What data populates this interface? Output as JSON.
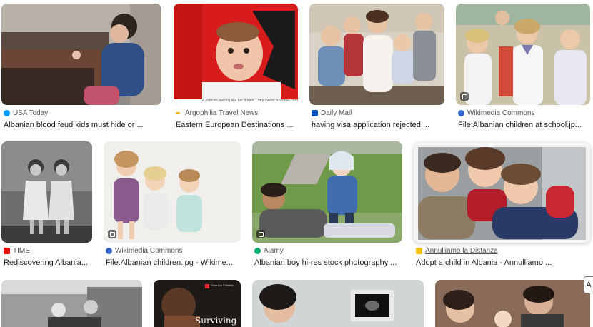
{
  "results": [
    {
      "source": "USA Today",
      "title": "Albanian blood feud kids must hide or ...",
      "favicon_color": "#009bff"
    },
    {
      "source": "Argophilia Travel News",
      "title": "Eastern European Destinations ...",
      "favicon_color": "#f4b400"
    },
    {
      "source": "Daily Mail",
      "title": "having visa application rejected ...",
      "favicon_color": "#004db3"
    },
    {
      "source": "Wikimedia Commons",
      "title": "File:Albanian children at school.jp...",
      "favicon_color": "#3366cc"
    },
    {
      "source": "TIME",
      "title": "Rediscovering Albania...",
      "favicon_color": "#e90606"
    },
    {
      "source": "Wikimedia Commons",
      "title": "File:Albanian children.jpg - Wikime...",
      "favicon_color": "#3366cc"
    },
    {
      "source": "Alamy",
      "title": "Albanian boy hi-res stock photography ...",
      "favicon_color": "#00a86b"
    },
    {
      "source": "Annulliamo la Distanza",
      "title": "Adopt a child in Albania - Annulliamo ...",
      "favicon_color": "#f2c200"
    }
  ],
  "thumb_texts": {
    "argophilia_caption": "A patriotic-looking like her dream ...http://www.facebook.com/album",
    "surviving": "Surviving",
    "save_children": "Save the Children"
  },
  "edge_label": "A"
}
